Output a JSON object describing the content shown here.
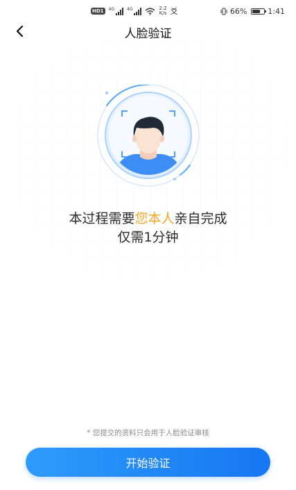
{
  "status_bar": {
    "hd": "HD",
    "hd_sub": "1",
    "net1": "4G",
    "net2": "4G",
    "speed_value": "2.2",
    "speed_unit": "K/s",
    "extra_icon": "爻",
    "battery_percent": "66%",
    "battery_level": 0.66,
    "time": "1:41"
  },
  "nav": {
    "back_icon": "chevron-left-icon",
    "title": "人脸验证"
  },
  "illustration": {
    "icon": "face-avatar-icon",
    "ring_color": "#5aa9ff",
    "frame_color": "#49a0ff",
    "shirt_color": "#3d8df5",
    "hair_color": "#1f2a36",
    "skin_color": "#fbe3d3"
  },
  "instruction": {
    "line1_before": "本过程需要",
    "line1_highlight": "您本人",
    "line1_after": "亲自完成",
    "line2": "仅需1分钟"
  },
  "highlight_color": "#f5a623",
  "footer": {
    "note": "* 您提交的资料只会用于人脸验证审核",
    "start_button": "开始验证"
  },
  "accent_color": "#1a7ef5"
}
